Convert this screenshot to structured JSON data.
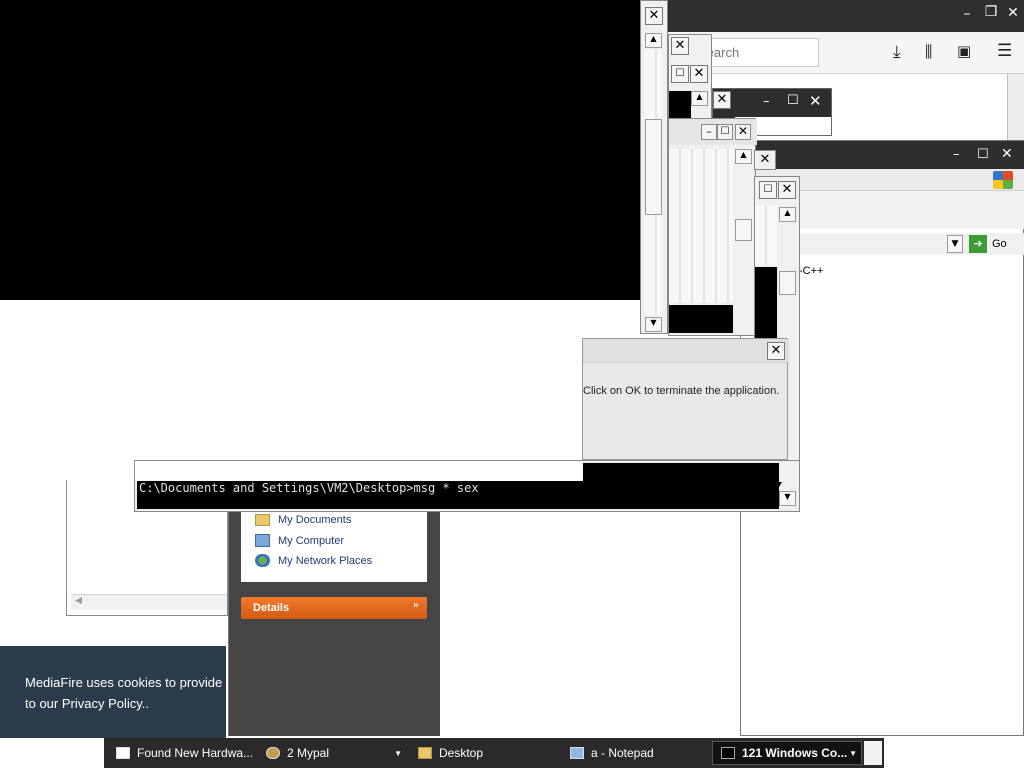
{
  "browser": {
    "search_placeholder": "Search",
    "min": "–",
    "restore": "❐",
    "close": "✕",
    "download_icon": "⤓",
    "library_icon": "⫼",
    "sidebar_icon": "▣",
    "menu_icon": "☰"
  },
  "ie_window": {
    "go_label": "Go",
    "partial_text": "-C++"
  },
  "error_dialog": {
    "message": "Click on OK to terminate the application."
  },
  "console": {
    "command_line": "C:\\Documents and Settings\\VM2\\Desktop>msg * sex"
  },
  "explorer": {
    "places": [
      {
        "label": "My Documents"
      },
      {
        "label": "My Computer"
      },
      {
        "label": "My Network Places"
      }
    ],
    "details_label": "Details"
  },
  "cookie_banner": {
    "line1": "MediaFire uses cookies to provide",
    "line2": "to our Privacy Policy.."
  },
  "taskbar": {
    "items": [
      {
        "label": "Found New Hardwa..."
      },
      {
        "label": "2 Mypal"
      },
      {
        "label": "Desktop"
      },
      {
        "label": "a - Notepad"
      },
      {
        "label": "121 Windows Co..."
      }
    ]
  },
  "colors": {
    "taskbar": "#2a2a2a",
    "details_bar": "#e2661a",
    "explorer_sidebar": "#454545",
    "console_bg": "#000000",
    "cookie_bg": "#2b3b4c"
  }
}
